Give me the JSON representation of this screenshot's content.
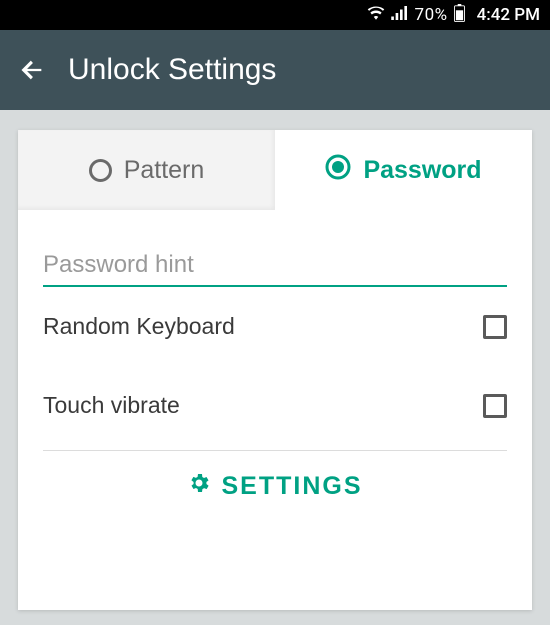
{
  "status": {
    "battery_pct": "70%",
    "time": "4:42 PM"
  },
  "header": {
    "title": "Unlock Settings"
  },
  "tabs": {
    "pattern": {
      "label": "Pattern",
      "selected": false
    },
    "password": {
      "label": "Password",
      "selected": true
    }
  },
  "hint": {
    "placeholder": "Password hint",
    "value": ""
  },
  "options": {
    "random_keyboard": {
      "label": "Random Keyboard",
      "checked": false
    },
    "touch_vibrate": {
      "label": "Touch vibrate",
      "checked": false
    }
  },
  "footer": {
    "settings_label": "SETTINGS"
  },
  "colors": {
    "accent": "#00a183",
    "appbar": "#3e5159"
  }
}
